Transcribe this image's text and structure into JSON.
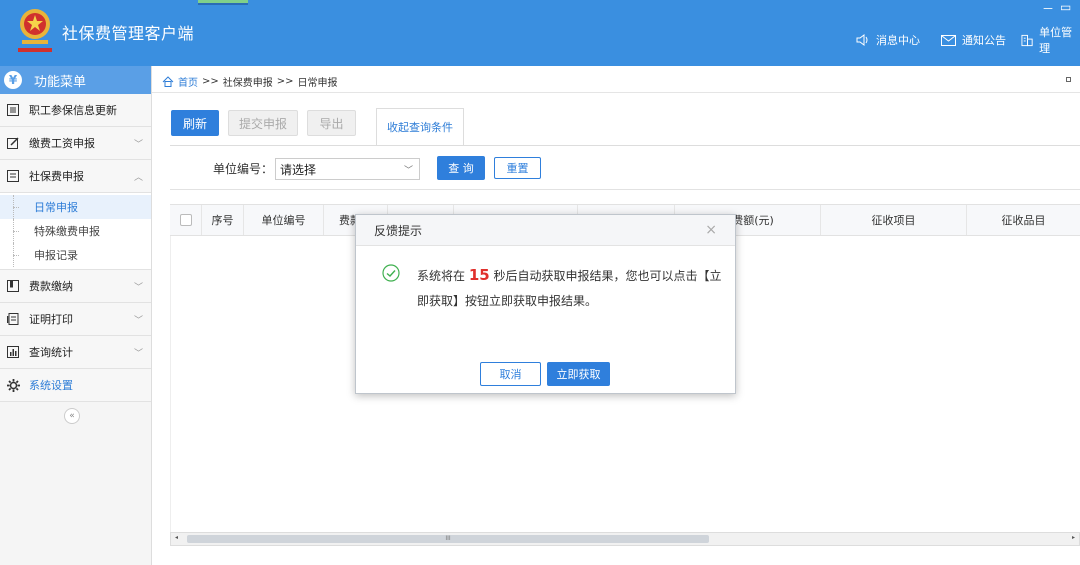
{
  "header": {
    "title": "社保费管理客户端",
    "nav": [
      {
        "label": "消息中心",
        "icon": "speaker-icon"
      },
      {
        "label": "通知公告",
        "icon": "mail-icon"
      },
      {
        "label": "单位管理",
        "icon": "building-icon"
      }
    ],
    "window_controls": {
      "minimize": "－",
      "maximize": "▭"
    }
  },
  "sidebar": {
    "title": "功能菜单",
    "title_icon": "¥",
    "items": [
      {
        "label": "职工参保信息更新",
        "icon": "list-icon"
      },
      {
        "label": "缴费工资申报",
        "icon": "edit-icon",
        "chevron": "﹀"
      },
      {
        "label": "社保费申报",
        "icon": "doc-icon",
        "chevron": "︿"
      },
      {
        "label": "费款缴纳",
        "icon": "book-icon",
        "chevron": "﹀"
      },
      {
        "label": "证明打印",
        "icon": "print-icon",
        "chevron": "﹀"
      },
      {
        "label": "查询统计",
        "icon": "chart-icon",
        "chevron": "﹀"
      },
      {
        "label": "系统设置",
        "icon": "gear-icon"
      }
    ],
    "sub_items": [
      "日常申报",
      "特殊缴费申报",
      "申报记录"
    ],
    "collapse": "«"
  },
  "breadcrumb": {
    "home": "首页",
    "sep": ">>",
    "level1": "社保费申报",
    "level2": "日常申报"
  },
  "toolbar": {
    "refresh": "刷新",
    "submit": "提交申报",
    "export": "导出",
    "collapse_query": "收起查询条件"
  },
  "query": {
    "label": "单位编号：",
    "select_value": "请选择",
    "search": "查 询",
    "reset": "重置"
  },
  "table": {
    "columns": [
      "序号",
      "单位编号",
      "费款所",
      "",
      "",
      "",
      "缴费额(元)",
      "征收项目",
      "征收品目"
    ]
  },
  "scrollbar": {
    "left": "◂",
    "thumb": "III",
    "right": "▸"
  },
  "dialog": {
    "title": "反馈提示",
    "close": "×",
    "text_before": "系统将在 ",
    "countdown": "15",
    "text_after": " 秒后自动获取申报结果，您也可以点击【立即获取】按钮立即获取申报结果。",
    "cancel": "取消",
    "confirm": "立即获取"
  },
  "colors": {
    "header": "#3a8fe0",
    "primary": "#2f7fdc",
    "countdown": "#e0302c"
  }
}
